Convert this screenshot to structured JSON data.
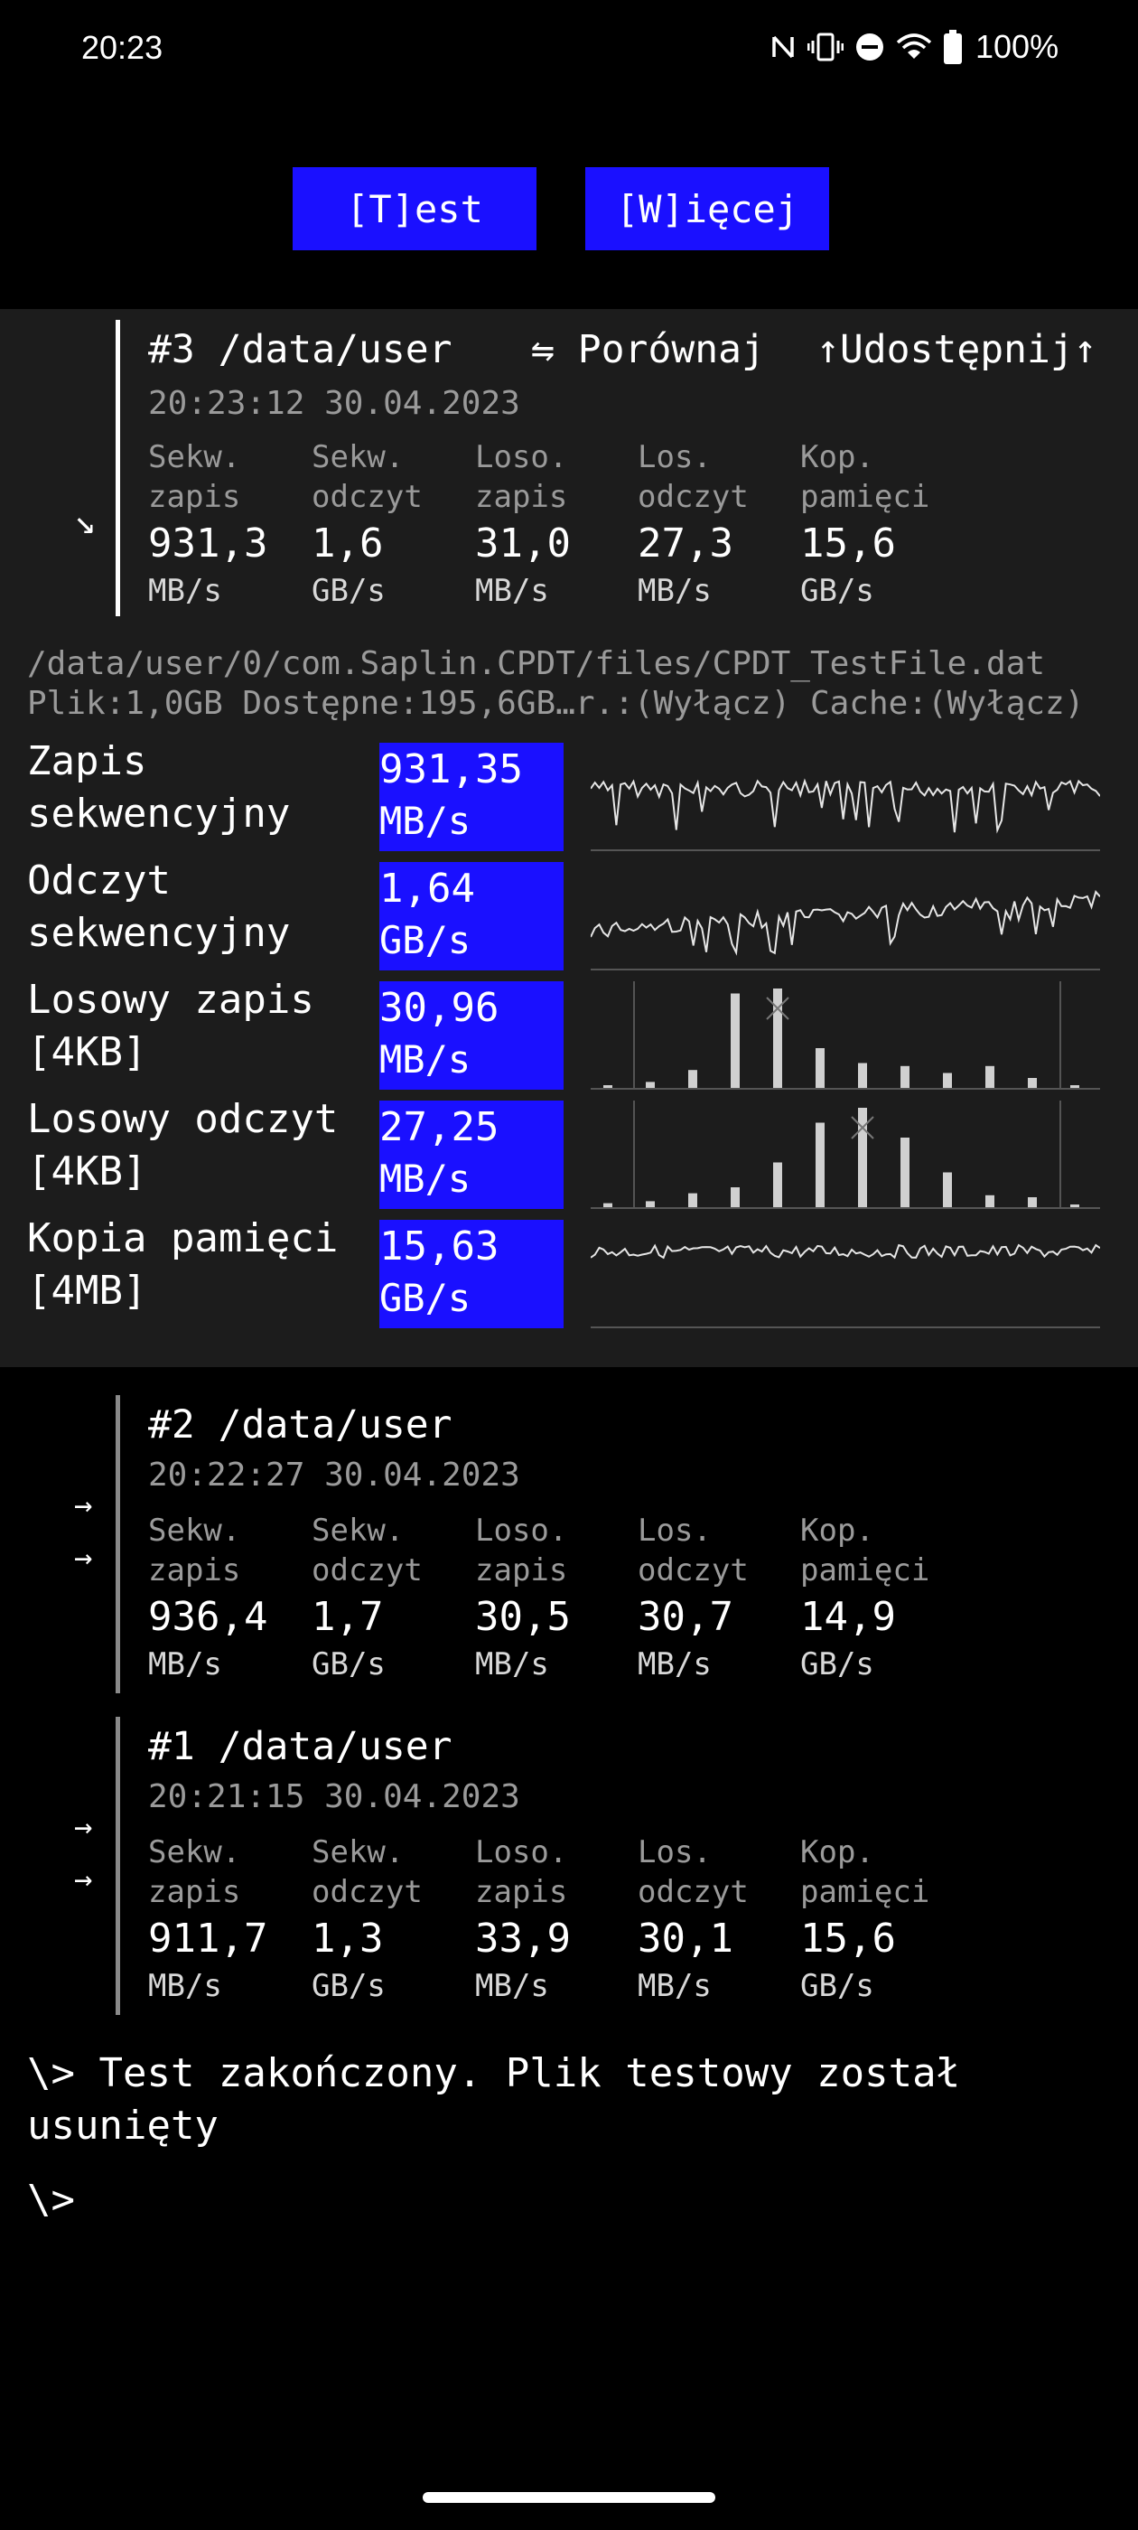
{
  "status": {
    "time": "20:23",
    "battery": "100%",
    "icons": [
      "nfc-icon",
      "vibrate-icon",
      "dnd-icon",
      "wifi-icon",
      "battery-icon"
    ]
  },
  "buttons": {
    "test": "[T]est",
    "more": "[W]ięcej"
  },
  "colors": {
    "accent": "#1a10ff",
    "panel_bg": "#1c1c1c",
    "muted": "#9a9a9a"
  },
  "metric_labels": [
    [
      "Sekw.",
      "zapis"
    ],
    [
      "Sekw.",
      "odczyt"
    ],
    [
      "Loso.",
      "zapis"
    ],
    [
      "Los.",
      "odczyt"
    ],
    [
      "Kop.",
      "pamięci"
    ]
  ],
  "current": {
    "title": "#3 /data/user",
    "timestamp": "20:23:12 30.04.2023",
    "compare": "⇋ Porównaj",
    "share": "↑Udostępnij↑",
    "collapse_icon": "↘",
    "values": [
      {
        "value": "931,3",
        "unit": "MB/s"
      },
      {
        "value": "1,6",
        "unit": "GB/s"
      },
      {
        "value": "31,0",
        "unit": "MB/s"
      },
      {
        "value": "27,3",
        "unit": "MB/s"
      },
      {
        "value": "15,6",
        "unit": "GB/s"
      }
    ],
    "file_path": "/data/user/0/com.Saplin.CPDT/files/CPDT_TestFile.dat",
    "file_info": "Plik:1,0GB Dostępne:195,6GB…r.:(Wyłącz) Cache:(Wyłącz)",
    "tests": [
      {
        "name_line1": "Zapis",
        "name_line2": "sekwencyjny",
        "value": "931,35",
        "unit": "MB/s",
        "graph": "line"
      },
      {
        "name_line1": "Odczyt",
        "name_line2": "sekwencyjny",
        "value": "1,64",
        "unit": "GB/s",
        "graph": "line"
      },
      {
        "name_line1": "Losowy zapis",
        "name_line2": "[4KB]",
        "value": "30,96",
        "unit": "MB/s",
        "graph": "histogram",
        "bars": [
          0.02,
          0.06,
          0.18,
          0.95,
          1.0,
          0.4,
          0.25,
          0.22,
          0.15,
          0.22,
          0.1,
          0.02
        ]
      },
      {
        "name_line1": "Losowy odczyt",
        "name_line2": "[4KB]",
        "value": "27,25",
        "unit": "MB/s",
        "graph": "histogram",
        "bars": [
          0.04,
          0.06,
          0.14,
          0.2,
          0.45,
          0.85,
          1.0,
          0.7,
          0.35,
          0.12,
          0.1,
          0.02
        ]
      },
      {
        "name_line1": "Kopia pamięci",
        "name_line2": "[4MB]",
        "value": "15,63",
        "unit": "GB/s",
        "graph": "line"
      }
    ]
  },
  "history": [
    {
      "title": "#2 /data/user",
      "timestamp": "20:22:27 30.04.2023",
      "arrows": [
        "→",
        "→"
      ],
      "values": [
        {
          "value": "936,4",
          "unit": "MB/s"
        },
        {
          "value": "1,7",
          "unit": "GB/s"
        },
        {
          "value": "30,5",
          "unit": "MB/s"
        },
        {
          "value": "30,7",
          "unit": "MB/s"
        },
        {
          "value": "14,9",
          "unit": "GB/s"
        }
      ]
    },
    {
      "title": "#1 /data/user",
      "timestamp": "20:21:15 30.04.2023",
      "arrows": [
        "→",
        "→"
      ],
      "values": [
        {
          "value": "911,7",
          "unit": "MB/s"
        },
        {
          "value": "1,3",
          "unit": "GB/s"
        },
        {
          "value": "33,9",
          "unit": "MB/s"
        },
        {
          "value": "30,1",
          "unit": "MB/s"
        },
        {
          "value": "15,6",
          "unit": "GB/s"
        }
      ]
    }
  ],
  "console": {
    "message_line1": "\\> Test zakończony. Plik testowy został",
    "message_line2": "usunięty",
    "prompt": "\\>"
  }
}
